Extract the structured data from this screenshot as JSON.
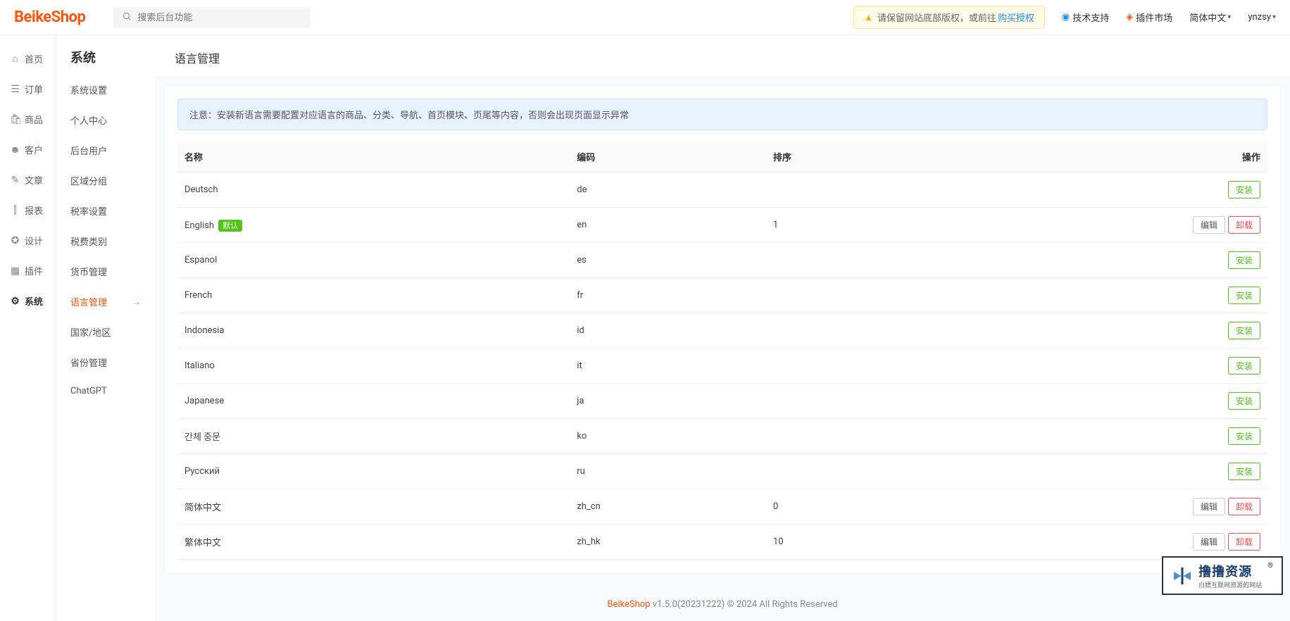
{
  "header": {
    "logo": "BeikeShop",
    "search_placeholder": "搜索后台功能",
    "notice_text": "请保留网站底部版权，或前往",
    "notice_link": "购买授权",
    "tech_support": "技术支持",
    "plugin_market": "插件市场",
    "language": "简体中文",
    "username": "ynzsy"
  },
  "nav1": [
    {
      "icon": "⌂",
      "label": "首页"
    },
    {
      "icon": "☰",
      "label": "订单"
    },
    {
      "icon": "🛍",
      "label": "商品"
    },
    {
      "icon": "☻",
      "label": "客户"
    },
    {
      "icon": "✎",
      "label": "文章"
    },
    {
      "icon": "⫿",
      "label": "报表"
    },
    {
      "icon": "✪",
      "label": "设计"
    },
    {
      "icon": "▦",
      "label": "插件"
    },
    {
      "icon": "⚙",
      "label": "系统"
    }
  ],
  "nav2": {
    "title": "系统",
    "items": [
      "系统设置",
      "个人中心",
      "后台用户",
      "区域分组",
      "税率设置",
      "税费类别",
      "货币管理",
      "语言管理",
      "国家/地区",
      "省份管理",
      "ChatGPT"
    ]
  },
  "page": {
    "title": "语言管理",
    "alert": "注意：安装新语言需要配置对应语言的商品、分类、导航、首页模块、页尾等内容，否则会出现页面显示异常"
  },
  "table": {
    "headers": {
      "name": "名称",
      "code": "编码",
      "sort": "排序",
      "action": "操作"
    },
    "rows": [
      {
        "name": "Deutsch",
        "code": "de",
        "sort": "",
        "default": false,
        "installed": false
      },
      {
        "name": "English",
        "code": "en",
        "sort": "1",
        "default": true,
        "installed": true
      },
      {
        "name": "Espanol",
        "code": "es",
        "sort": "",
        "default": false,
        "installed": false
      },
      {
        "name": "French",
        "code": "fr",
        "sort": "",
        "default": false,
        "installed": false
      },
      {
        "name": "Indonesia",
        "code": "id",
        "sort": "",
        "default": false,
        "installed": false
      },
      {
        "name": "Italiano",
        "code": "it",
        "sort": "",
        "default": false,
        "installed": false
      },
      {
        "name": "Japanese",
        "code": "ja",
        "sort": "",
        "default": false,
        "installed": false
      },
      {
        "name": "간체 중문",
        "code": "ko",
        "sort": "",
        "default": false,
        "installed": false
      },
      {
        "name": "Русский",
        "code": "ru",
        "sort": "",
        "default": false,
        "installed": false
      },
      {
        "name": "简体中文",
        "code": "zh_cn",
        "sort": "0",
        "default": false,
        "installed": true
      },
      {
        "name": "繁体中文",
        "code": "zh_hk",
        "sort": "10",
        "default": false,
        "installed": true
      }
    ]
  },
  "labels": {
    "default_badge": "默认",
    "install": "安装",
    "edit": "编辑",
    "uninstall": "卸载"
  },
  "footer": {
    "brand": "BeikeShop",
    "rest": " v1.5.0(20231222) © 2024 All Rights Reserved"
  },
  "watermark": {
    "t1": "撸撸资源",
    "t2": "白嫖互联网资源的网站"
  }
}
